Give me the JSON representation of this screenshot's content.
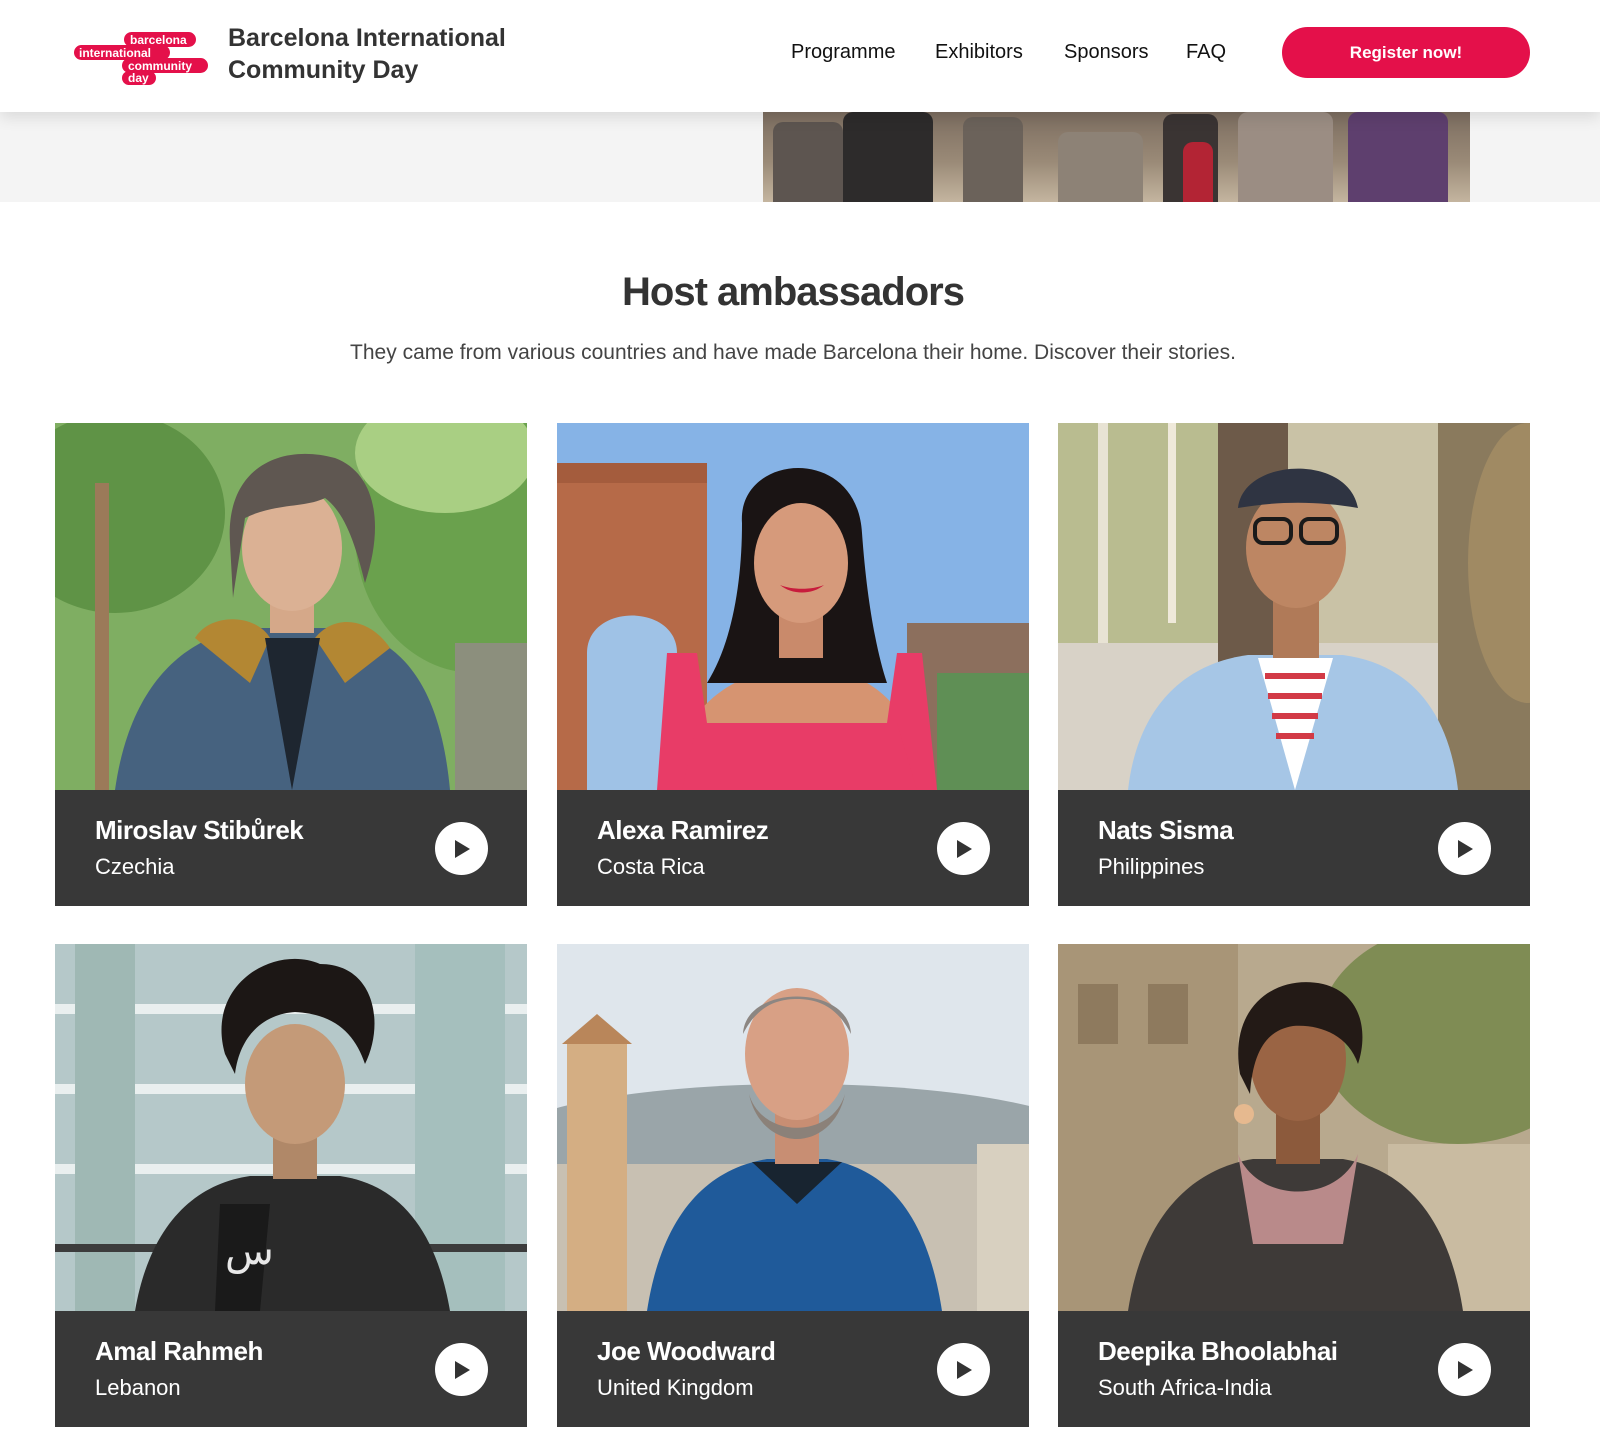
{
  "header": {
    "logo_words": [
      "barcelona",
      "international",
      "community",
      "day"
    ],
    "title_line1": "Barcelona International",
    "title_line2": "Community Day",
    "nav": {
      "programme": "Programme",
      "exhibitors": "Exhibitors",
      "sponsors": "Sponsors",
      "faq": "FAQ"
    },
    "register_label": "Register now!"
  },
  "section": {
    "title": "Host ambassadors",
    "subtitle": "They came from various countries and have made Barcelona their home. Discover their stories."
  },
  "ambassadors": [
    {
      "name": "Miroslav Stibůrek",
      "country": "Czechia"
    },
    {
      "name": "Alexa Ramirez",
      "country": "Costa Rica"
    },
    {
      "name": "Nats Sisma",
      "country": "Philippines"
    },
    {
      "name": "Amal Rahmeh",
      "country": "Lebanon"
    },
    {
      "name": "Joe Woodward",
      "country": "United Kingdom"
    },
    {
      "name": "Deepika Bhoolabhai",
      "country": "South Africa-India"
    }
  ],
  "colors": {
    "accent": "#e4104a",
    "card_info_bg": "#383838",
    "text": "#333333"
  },
  "icons": {
    "play": "play-icon"
  }
}
